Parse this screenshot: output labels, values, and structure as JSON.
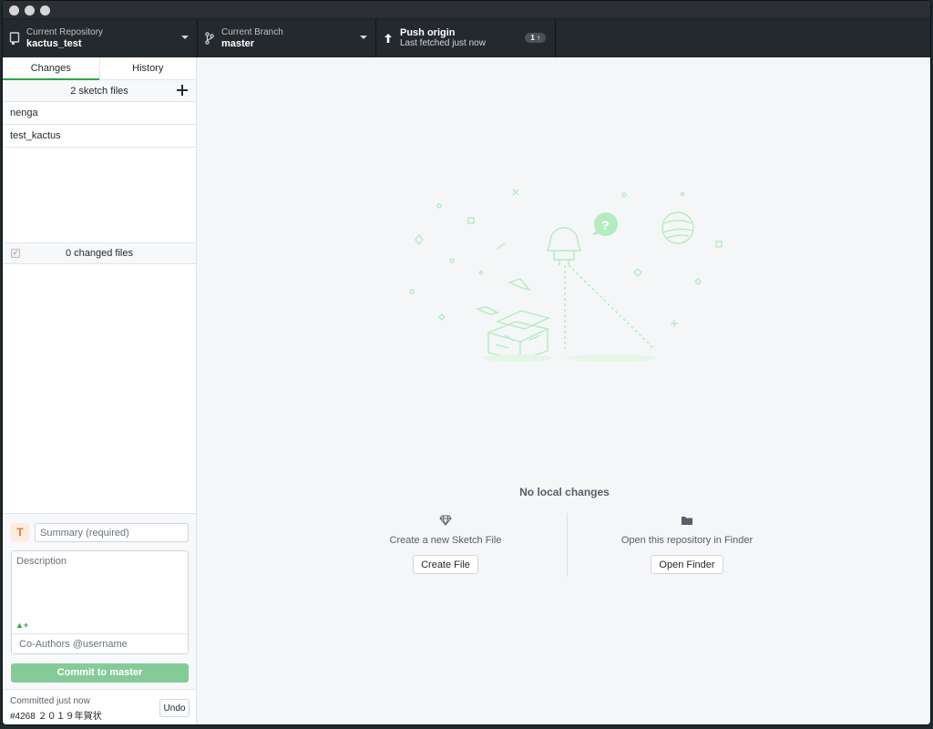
{
  "toolbar": {
    "repo_label": "Current Repository",
    "repo_name": "kactus_test",
    "branch_label": "Current Branch",
    "branch_name": "master",
    "push_title": "Push origin",
    "push_sub": "Last fetched just now",
    "push_badge": "1 ↑"
  },
  "sidebar": {
    "tabs": [
      {
        "label": "Changes",
        "active": true
      },
      {
        "label": "History",
        "active": false
      }
    ],
    "files_header": "2 sketch files",
    "files": [
      "nenga",
      "test_kactus"
    ],
    "changed_header": "0 changed files"
  },
  "commit": {
    "avatar_initial": "T",
    "summary_placeholder": "Summary (required)",
    "description_placeholder": "Description",
    "coauthor_placeholder": "Co-Authors @username",
    "commit_button_prefix": "Commit to ",
    "commit_button_branch": "master"
  },
  "last_commit": {
    "label": "Committed just now",
    "message": "#4268 ２０１９年賀状",
    "undo_label": "Undo"
  },
  "main": {
    "no_changes": "No local changes",
    "create_text": "Create a new Sketch File",
    "create_button": "Create File",
    "finder_text": "Open this repository in Finder",
    "finder_button": "Open Finder"
  },
  "colors": {
    "accent_green": "#28a745",
    "illustration_green": "#b4ecc0",
    "commit_button": "#85cb99",
    "toolbar_bg": "#24292e"
  }
}
